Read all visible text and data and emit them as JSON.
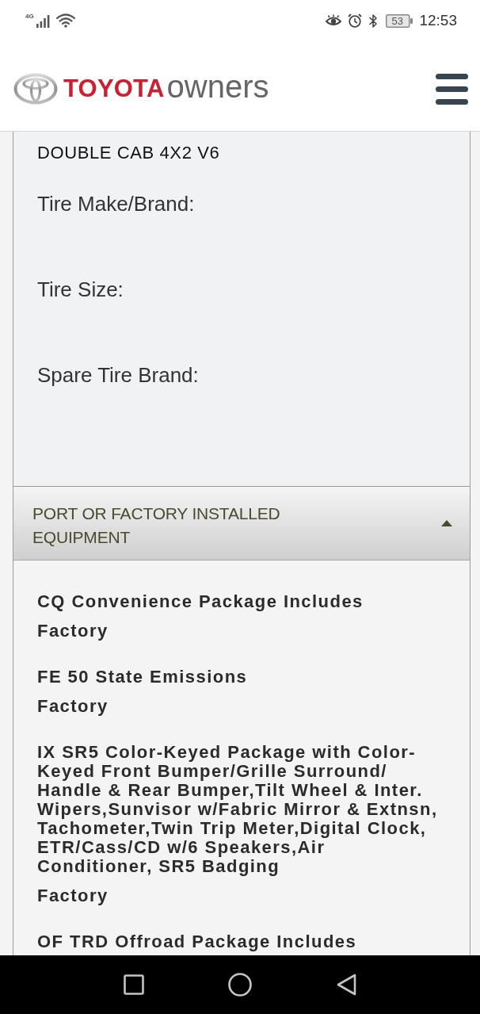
{
  "status_bar": {
    "network": "4G",
    "battery": "53",
    "time": "12:53"
  },
  "header": {
    "brand": "TOYOTA",
    "brand_suffix": "owners"
  },
  "vehicle_section": {
    "model": "DOUBLE CAB 4X2 V6",
    "fields": [
      {
        "label": "Tire Make/Brand:"
      },
      {
        "label": "Tire Size:"
      },
      {
        "label": "Spare Tire Brand:"
      }
    ]
  },
  "equipment_section": {
    "title": "PORT OR FACTORY INSTALLED EQUIPMENT",
    "expanded": true,
    "items": [
      {
        "name": "CQ Convenience Package Includes",
        "source": "Factory"
      },
      {
        "name": "FE 50 State Emissions",
        "source": "Factory"
      },
      {
        "name": "IX SR5 Color-Keyed Package with Color-Keyed Front Bumper/Grille Surround/Handle & Rear Bumper,Tilt Wheel & Inter. Wipers,Sunvisor w/Fabric Mirror & Extnsn, Tachometer,Twin Trip Meter,Digital Clock, ETR/Cass/CD w/6 Speakers,Air Conditioner, SR5 Badging",
        "source": "Factory"
      },
      {
        "name": "OF TRD Offroad Package Includes"
      }
    ]
  }
}
